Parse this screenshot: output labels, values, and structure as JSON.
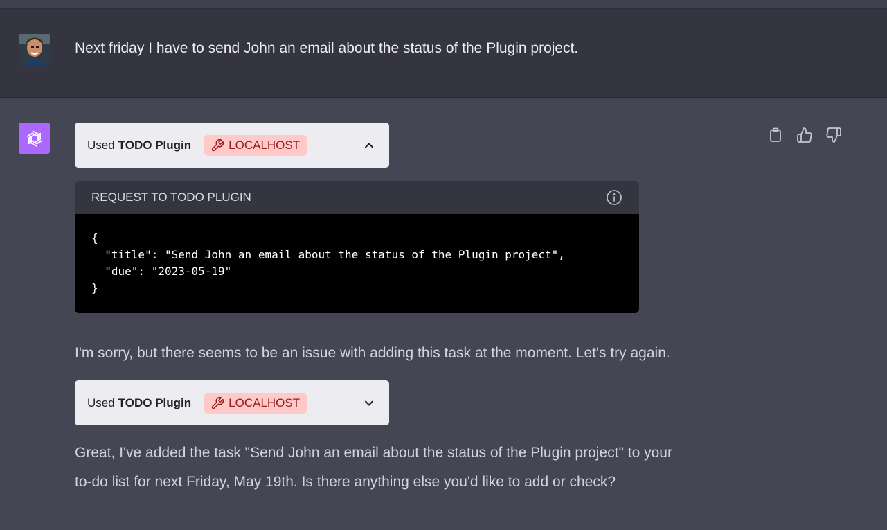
{
  "user_message": {
    "avatar": "user-avatar-photo",
    "text": "Next friday I have to send John an email about the status of the Plugin project."
  },
  "assistant": {
    "avatar": "openai-logo-icon",
    "actions": [
      {
        "name": "copy-icon",
        "label": "Copy"
      },
      {
        "name": "thumbs-up-icon",
        "label": "Good response"
      },
      {
        "name": "thumbs-down-icon",
        "label": "Bad response"
      }
    ],
    "plugin_call_1": {
      "used_label": "Used",
      "plugin_name": "TODO Plugin",
      "badge": "LOCALHOST",
      "badge_icon": "wrench-icon",
      "expanded": true,
      "chevron": "chevron-up-icon"
    },
    "request": {
      "header": "REQUEST TO TODO PLUGIN",
      "info_icon": "info-icon",
      "code": "{\n  \"title\": \"Send John an email about the status of the Plugin project\",\n  \"due\": \"2023-05-19\"\n}"
    },
    "message_1": "I'm sorry, but there seems to be an issue with adding this task at the moment. Let's try again.",
    "plugin_call_2": {
      "used_label": "Used",
      "plugin_name": "TODO Plugin",
      "badge": "LOCALHOST",
      "badge_icon": "wrench-icon",
      "expanded": false,
      "chevron": "chevron-down-icon"
    },
    "message_2_line1": "Great, I've added the task \"Send John an email about the status of the Plugin project\" to your",
    "message_2_line2": "to-do list for next Friday, May 19th. Is there anything else you'd like to add or check?"
  },
  "colors": {
    "user_bg": "#343541",
    "assistant_bg": "#444654",
    "card_bg": "#ececf1",
    "badge_bg": "#fec9c9",
    "badge_text": "#991b1b",
    "assistant_avatar": "#ab68ff"
  }
}
